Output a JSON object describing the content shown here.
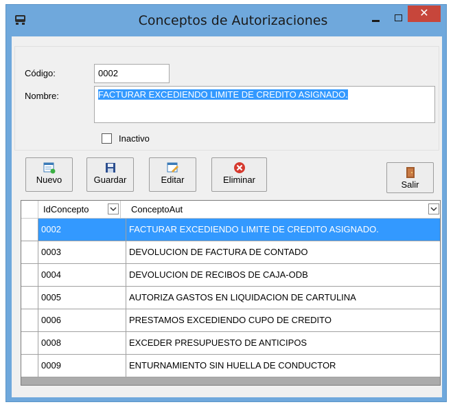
{
  "window": {
    "title": "Conceptos de Autorizaciones",
    "close_glyph": "✕"
  },
  "form": {
    "codigo_label": "Código:",
    "codigo_value": "0002",
    "nombre_label": "Nombre:",
    "nombre_value": "FACTURAR EXCEDIENDO LIMITE DE CREDITO ASIGNADO.",
    "inactivo_label": "Inactivo",
    "inactivo_checked": false
  },
  "toolbar": {
    "nuevo": "Nuevo",
    "guardar": "Guardar",
    "editar": "Editar",
    "eliminar": "Eliminar",
    "salir": "Salir"
  },
  "grid": {
    "columns": [
      "IdConcepto",
      "ConceptoAut"
    ],
    "selected_row": 0,
    "rows": [
      [
        "0002",
        "FACTURAR EXCEDIENDO LIMITE DE CREDITO ASIGNADO."
      ],
      [
        "0003",
        "DEVOLUCION DE FACTURA DE CONTADO"
      ],
      [
        "0004",
        "DEVOLUCION DE RECIBOS DE CAJA-ODB"
      ],
      [
        "0005",
        "AUTORIZA GASTOS EN LIQUIDACION DE CARTULINA"
      ],
      [
        "0006",
        "PRESTAMOS EXCEDIENDO CUPO DE CREDITO"
      ],
      [
        "0008",
        "EXCEDER PRESUPUESTO DE ANTICIPOS"
      ],
      [
        "0009",
        "ENTURNAMIENTO SIN HUELLA DE CONDUCTOR"
      ]
    ]
  },
  "colors": {
    "titlebar": "#6fa8dc",
    "selection": "#3399ff",
    "close_button": "#c7463b"
  }
}
